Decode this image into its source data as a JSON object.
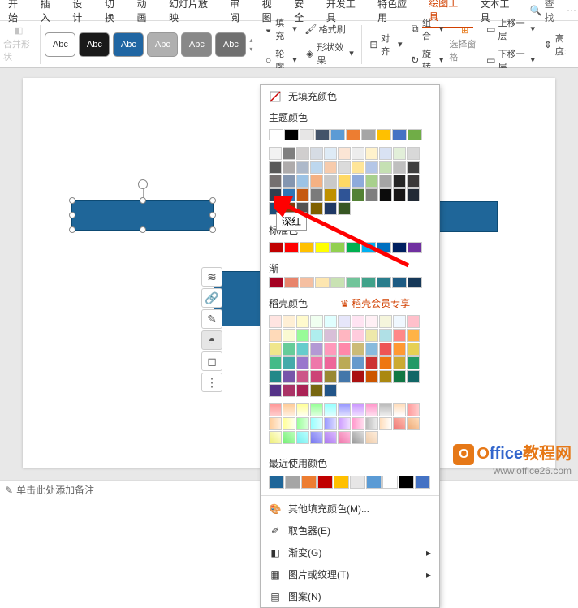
{
  "menu": {
    "tabs": [
      "开始",
      "插入",
      "设计",
      "切换",
      "动画",
      "幻灯片放映",
      "审阅",
      "视图",
      "安全",
      "开发工具",
      "特色应用",
      "绘图工具",
      "文本工具"
    ],
    "active_index": 11,
    "search": "查找"
  },
  "ribbon": {
    "merge_shapes": "合并形状",
    "abc": "Abc",
    "fill": "填充",
    "outline": "轮廓",
    "format_painter": "格式刷",
    "shape_effects": "形状效果",
    "align": "对齐",
    "group": "组合",
    "rotate": "旋转",
    "selection_pane": "选择窗格",
    "bring_forward": "上移一层",
    "send_backward": "下移一层",
    "height": "高度:"
  },
  "color_panel": {
    "no_fill": "无填充颜色",
    "theme": "主题颜色",
    "standard": "标准色",
    "gradient_preset": "渐",
    "tooltip": "深红",
    "dk_colors": "稻壳颜色",
    "dk_members": "稻壳会员专享",
    "recent": "最近使用颜色",
    "more_fill": "其他填充颜色(M)...",
    "eyedropper": "取色器(E)",
    "gradient": "渐变(G)",
    "texture": "图片或纹理(T)",
    "pattern": "图案(N)",
    "theme_row1": [
      "#ffffff",
      "#000000",
      "#e7e6e6",
      "#44546a",
      "#5b9bd5",
      "#ed7d31",
      "#a5a5a5",
      "#ffc000",
      "#4472c4",
      "#70ad47"
    ],
    "theme_grid": [
      [
        "#f2f2f2",
        "#7f7f7f",
        "#d0cece",
        "#d6dce4",
        "#deebf6",
        "#fbe5d5",
        "#ededed",
        "#fff2cc",
        "#d9e2f3",
        "#e2efd9"
      ],
      [
        "#d8d8d8",
        "#595959",
        "#aeabab",
        "#adb9ca",
        "#bdd7ee",
        "#f7cbac",
        "#dbdbdb",
        "#fee599",
        "#b4c6e7",
        "#c5e0b3"
      ],
      [
        "#bfbfbf",
        "#3f3f3f",
        "#757070",
        "#8496b0",
        "#9cc3e5",
        "#f4b183",
        "#c9c9c9",
        "#ffd965",
        "#8eaadb",
        "#a8d08d"
      ],
      [
        "#a5a5a5",
        "#262626",
        "#3a3838",
        "#323f4f",
        "#2e75b5",
        "#c55a11",
        "#7b7b7b",
        "#bf9000",
        "#2f5496",
        "#538135"
      ],
      [
        "#7f7f7f",
        "#0c0c0c",
        "#171616",
        "#222a35",
        "#1e4e79",
        "#833c0b",
        "#525252",
        "#7f6000",
        "#1f3864",
        "#375623"
      ]
    ],
    "standard_row": [
      "#c00000",
      "#ff0000",
      "#ffc000",
      "#ffff00",
      "#92d050",
      "#00b050",
      "#00b0f0",
      "#0070c0",
      "#002060",
      "#7030a0"
    ],
    "grad_row": [
      "#a50021",
      "#e8846b",
      "#f5bfa1",
      "#fde6b0",
      "#c9e2b3",
      "#71c49a",
      "#41a28a",
      "#2a7d8c",
      "#1d5b83",
      "#163858"
    ],
    "dk_grid": [
      [
        "#ffe4e1",
        "#ffefd5",
        "#fffacd",
        "#f0fff0",
        "#e0ffff",
        "#e6e6fa",
        "#ffe4f2",
        "#fff0f5",
        "#f5f5dc",
        "#f0f8ff"
      ],
      [
        "#ffc0cb",
        "#ffdab9",
        "#fafad2",
        "#98fb98",
        "#afeeee",
        "#d8bfd8",
        "#ffb6c1",
        "#ffccdd",
        "#eee8aa",
        "#b0e0e6"
      ],
      [
        "#ff8888",
        "#ffb347",
        "#f0e68c",
        "#66cc99",
        "#66cccc",
        "#b399d4",
        "#ff99bb",
        "#ff88aa",
        "#ccbb77",
        "#88bbdd"
      ],
      [
        "#ee5555",
        "#ff9933",
        "#e6d055",
        "#44bb88",
        "#44aaaa",
        "#9977cc",
        "#ee77aa",
        "#ee6699",
        "#bbaa55",
        "#6699cc"
      ],
      [
        "#cc3333",
        "#ee7711",
        "#ccaa33",
        "#229966",
        "#228888",
        "#7755aa",
        "#cc5588",
        "#cc4477",
        "#998833",
        "#4477aa"
      ],
      [
        "#aa1111",
        "#cc5500",
        "#aa8811",
        "#117744",
        "#116666",
        "#553388",
        "#aa3366",
        "#aa2255",
        "#776611",
        "#225588"
      ]
    ],
    "grad_grid": [
      [
        "linear-gradient(#f99,#fcc)",
        "linear-gradient(#fc9,#fed)",
        "linear-gradient(#ff9,#ffe)",
        "linear-gradient(#9f9,#dfd)",
        "linear-gradient(#9ff,#dff)",
        "linear-gradient(#99f,#ddf)",
        "linear-gradient(#c9f,#edf)",
        "linear-gradient(#f9c,#fde)",
        "linear-gradient(#bbb,#eee)",
        "linear-gradient(#fdb,#fff)"
      ],
      [
        "linear-gradient(90deg,#f99,#fcc)",
        "linear-gradient(90deg,#fc9,#fed)",
        "linear-gradient(90deg,#ff9,#ffe)",
        "linear-gradient(90deg,#9f9,#dfd)",
        "linear-gradient(90deg,#9ff,#dff)",
        "linear-gradient(90deg,#99f,#ddf)",
        "linear-gradient(90deg,#c9f,#edf)",
        "linear-gradient(90deg,#f9c,#fde)",
        "linear-gradient(90deg,#bbb,#eee)",
        "linear-gradient(90deg,#fdb,#fff)"
      ],
      [
        "linear-gradient(45deg,#e77,#fba)",
        "linear-gradient(45deg,#ea7,#fdb)",
        "linear-gradient(45deg,#ee7,#ffd)",
        "linear-gradient(45deg,#7e7,#bfb)",
        "linear-gradient(45deg,#7ee,#bff)",
        "linear-gradient(45deg,#77e,#bbf)",
        "linear-gradient(45deg,#a7e,#dbf)",
        "linear-gradient(45deg,#e7a,#fbd)",
        "linear-gradient(45deg,#999,#ddd)",
        "linear-gradient(45deg,#eca,#fed)"
      ]
    ],
    "recent_row": [
      "#1f6699",
      "#a5a5a5",
      "#ed7d31",
      "#c00000",
      "#ffc000",
      "#e7e6e6",
      "#5b9bd5",
      "#ffffff",
      "#000000",
      "#4472c4"
    ]
  },
  "status": {
    "notes_placeholder": "单击此处添加备注"
  },
  "watermark": {
    "brand": "Office",
    "brand_cn": "教程网",
    "url": "www.office26.com",
    "badge": "O"
  }
}
